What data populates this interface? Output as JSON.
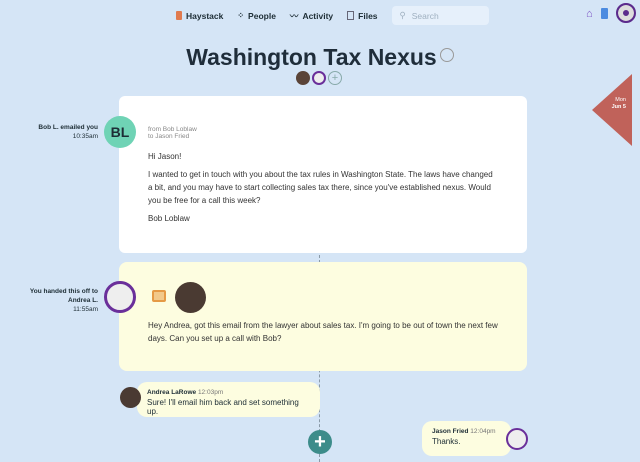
{
  "nav": {
    "items": [
      {
        "label": "Haystack",
        "icon": "stack-icon"
      },
      {
        "label": "People",
        "icon": "people-icon"
      },
      {
        "label": "Activity",
        "icon": "activity-icon"
      },
      {
        "label": "Files",
        "icon": "files-icon"
      }
    ],
    "search_placeholder": "Search"
  },
  "title": "Washington Tax Nexus",
  "date_flag": {
    "day": "Mon",
    "date": "Jun 5"
  },
  "email": {
    "side_label": "Bob L. emailed you",
    "time": "10:35am",
    "initials": "BL",
    "from": "from Bob Loblaw",
    "to": "to Jason Fried",
    "greeting": "Hi Jason!",
    "body": "I wanted to get in touch with you about the tax rules in Washington State. The laws have changed a bit, and you may have to start collecting sales tax there, since you've established nexus. Would you be free for a call this week?",
    "signature": "Bob Loblaw"
  },
  "handoff": {
    "side_label": "You handed this off to Andrea L.",
    "time": "11:55am",
    "message": "Hey Andrea, got this email from the lawyer about sales tax. I'm going to be out of town the next few days. Can you set up a call with Bob?"
  },
  "replies": [
    {
      "name": "Andrea LaRowe",
      "time": "12:03pm",
      "text": "Sure! I'll email him back and set something up."
    },
    {
      "name": "Jason Fried",
      "time": "12:04pm",
      "text": "Thanks."
    }
  ],
  "colors": {
    "bg": "#d5e5f6",
    "teal": "#3c8c8a",
    "flag": "#c0625a",
    "bl": "#6fd3b5",
    "yellow": "#fdfde0"
  }
}
